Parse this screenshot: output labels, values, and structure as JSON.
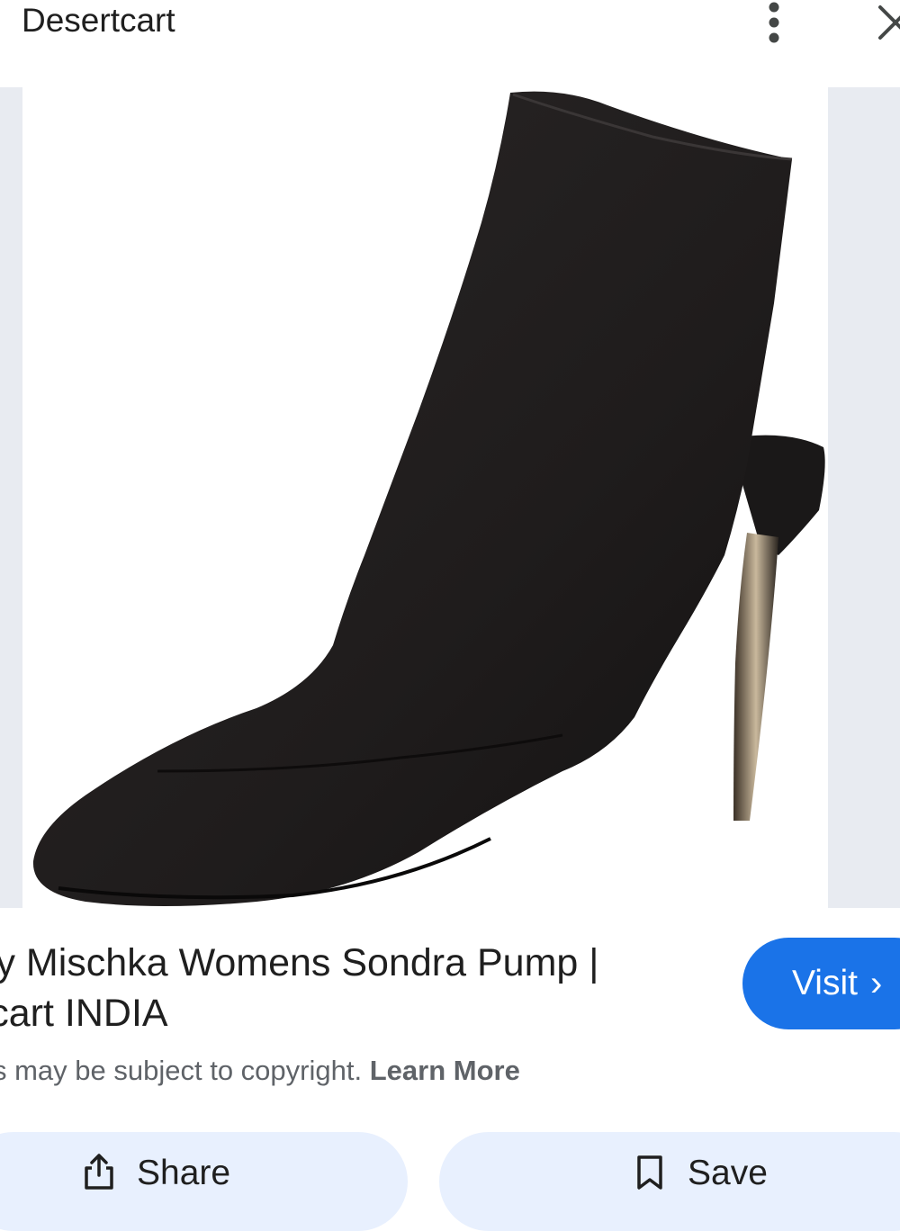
{
  "header": {
    "source_name": "Desertcart",
    "more_icon": "more-vert-icon",
    "close_icon": "close-icon"
  },
  "result": {
    "title_line1": "ley Mischka Womens Sondra Pump |",
    "title_line2": "rtcart INDIA",
    "copyright_text": "s may be subject to copyright.",
    "learn_more": "Learn More"
  },
  "actions": {
    "visit_label": "Visit",
    "visit_chevron": "›",
    "share_label": "Share",
    "save_label": "Save"
  },
  "colors": {
    "accent": "#1a73e8",
    "button_bg": "#e8f0fe",
    "side_strip": "#e8ebf1"
  }
}
